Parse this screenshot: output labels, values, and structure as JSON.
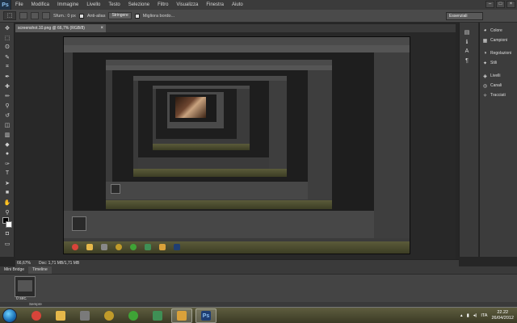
{
  "menu": {
    "logo": "Ps",
    "items": [
      "File",
      "Modifica",
      "Immagine",
      "Livello",
      "Testo",
      "Selezione",
      "Filtro",
      "Visualizza",
      "Finestra",
      "Aiuto"
    ],
    "window_controls": [
      "–",
      "□",
      "×"
    ]
  },
  "options_bar": {
    "tool_icon": "selection-tool-icon",
    "feather_label": "Sfum.: 0 px",
    "antialias_label": "Anti-alias",
    "style_value": "Stringere",
    "refine_label": "Migliora bordo...",
    "workspace": "Essenziali"
  },
  "document": {
    "tab_label": "screenshot.10.png @ 66,7% (RGB/8)",
    "zoom": "66,67%",
    "doc_info": "Doc: 1,71 MB/1,71 MB"
  },
  "right_panels": [
    {
      "icon": "colors-icon",
      "label": "Colore"
    },
    {
      "icon": "swatches-icon",
      "label": "Campioni"
    },
    {
      "icon": "adjustments-icon",
      "label": "Regolazioni"
    },
    {
      "icon": "styles-icon",
      "label": "Stili"
    },
    {
      "icon": "layers-icon",
      "label": "Livelli"
    },
    {
      "icon": "channels-icon",
      "label": "Canali"
    },
    {
      "icon": "paths-icon",
      "label": "Tracciati"
    }
  ],
  "timeline": {
    "tabs": [
      "Mini Bridge",
      "Timeline"
    ],
    "frame_label": "0 sec.",
    "footer": "Sempre"
  },
  "taskbar": {
    "apps": [
      {
        "name": "chrome-icon",
        "color": "#d8443a"
      },
      {
        "name": "explorer-icon",
        "color": "#e6b84a"
      },
      {
        "name": "toolbox-icon",
        "color": "#7a7a7a"
      },
      {
        "name": "winamp-icon",
        "color": "#c09b2a"
      },
      {
        "name": "utorrent-icon",
        "color": "#3fa336"
      },
      {
        "name": "app-green-icon",
        "color": "#3f8f55"
      },
      {
        "name": "media-player-icon",
        "color": "#d9a13a"
      },
      {
        "name": "photoshop-icon",
        "color": "#1f3e73"
      }
    ],
    "ps_glyph": "Ps",
    "lang": "ITA",
    "time": "22.22",
    "date": "26/04/2012"
  }
}
